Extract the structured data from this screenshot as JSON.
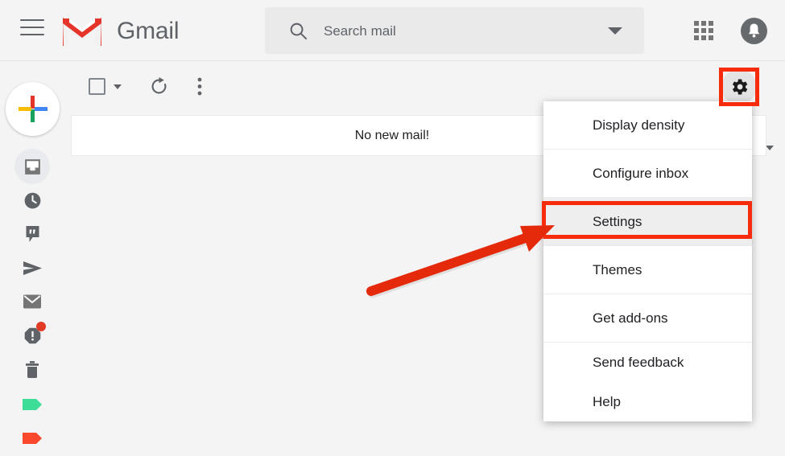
{
  "app": {
    "name": "Gmail",
    "brand_red": "#e5352b",
    "annotation_red": "#f72c0c"
  },
  "header": {
    "menu_icon": "hamburger-icon",
    "logo_icon": "gmail-envelope-logo",
    "wordmark": "Gmail",
    "search": {
      "placeholder": "Search mail",
      "value": "",
      "icon": "search-icon",
      "options_icon": "chevron-down-icon"
    },
    "apps_icon": "apps-grid-icon",
    "notifications_icon": "bell-icon"
  },
  "sidebar": {
    "compose": {
      "label": "Compose",
      "icon": "plus-icon"
    },
    "items": [
      {
        "name": "inbox",
        "icon": "inbox-icon",
        "active": true
      },
      {
        "name": "snoozed",
        "icon": "clock-icon",
        "active": false
      },
      {
        "name": "chat",
        "icon": "chat-bubble-icon",
        "active": false
      },
      {
        "name": "sent",
        "icon": "send-icon",
        "active": false
      },
      {
        "name": "mail",
        "icon": "envelope-icon",
        "active": false
      },
      {
        "name": "spam",
        "icon": "spam-octagon-icon",
        "active": false,
        "badge": true
      },
      {
        "name": "trash",
        "icon": "trash-icon",
        "active": false
      },
      {
        "name": "label-green",
        "icon": "label-tag-icon",
        "active": false,
        "color": "#3ddc97"
      },
      {
        "name": "label-red",
        "icon": "label-tag-icon",
        "active": false,
        "color": "#f9482b"
      }
    ]
  },
  "toolbar": {
    "select_all_icon": "checkbox-icon",
    "select_all_caret": "chevron-down-icon",
    "refresh_icon": "refresh-icon",
    "more_icon": "three-dots-vertical-icon",
    "keyboard_icon": "keyboard-icon",
    "keyboard_caret": "chevron-down-icon",
    "settings_icon": "gear-icon"
  },
  "main": {
    "empty_message": "No new mail!"
  },
  "settings_menu": {
    "groups": [
      {
        "items": [
          {
            "label": "Display density",
            "highlighted": false
          }
        ]
      },
      {
        "items": [
          {
            "label": "Configure inbox",
            "highlighted": false
          }
        ]
      },
      {
        "items": [
          {
            "label": "Settings",
            "highlighted": true
          }
        ]
      },
      {
        "items": [
          {
            "label": "Themes",
            "highlighted": false
          }
        ]
      },
      {
        "items": [
          {
            "label": "Get add-ons",
            "highlighted": false
          }
        ]
      },
      {
        "items": [
          {
            "label": "Send feedback",
            "highlighted": false
          },
          {
            "label": "Help",
            "highlighted": false
          }
        ]
      }
    ]
  },
  "annotations": {
    "gear_highlight": "red-rectangle-highlight",
    "settings_highlight": "red-rectangle-highlight",
    "pointer": "red-arrow-pointing-to-settings"
  }
}
